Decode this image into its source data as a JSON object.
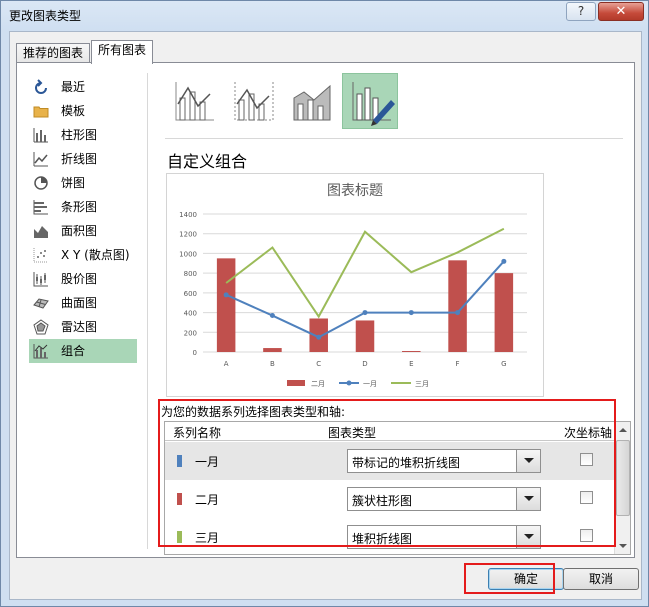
{
  "window": {
    "title": "更改图表类型",
    "help": "?",
    "close": "✕"
  },
  "tabs": [
    {
      "label": "推荐的图表"
    },
    {
      "label": "所有图表"
    }
  ],
  "sidebar": {
    "items": [
      {
        "label": "最近",
        "icon": "recent-icon"
      },
      {
        "label": "模板",
        "icon": "folder-icon"
      },
      {
        "label": "柱形图",
        "icon": "column-chart-icon"
      },
      {
        "label": "折线图",
        "icon": "line-chart-icon"
      },
      {
        "label": "饼图",
        "icon": "pie-chart-icon"
      },
      {
        "label": "条形图",
        "icon": "bar-chart-icon"
      },
      {
        "label": "面积图",
        "icon": "area-chart-icon"
      },
      {
        "label": "X Y (散点图)",
        "icon": "scatter-chart-icon"
      },
      {
        "label": "股价图",
        "icon": "stock-chart-icon"
      },
      {
        "label": "曲面图",
        "icon": "surface-chart-icon"
      },
      {
        "label": "雷达图",
        "icon": "radar-chart-icon"
      },
      {
        "label": "组合",
        "icon": "combo-chart-icon",
        "selected": true
      }
    ]
  },
  "combo_types": [
    {
      "icon": "combo-clustered-line-icon"
    },
    {
      "icon": "combo-clustered-line-secondary-icon"
    },
    {
      "icon": "combo-stacked-area-icon"
    },
    {
      "icon": "custom-combo-icon",
      "selected": true
    }
  ],
  "custom_combo": {
    "title": "自定义组合"
  },
  "chart_data": {
    "type": "bar",
    "title": "图表标题",
    "categories": [
      "A",
      "B",
      "C",
      "D",
      "E",
      "F",
      "G"
    ],
    "ylim": [
      0,
      1400
    ],
    "yticks": [
      0,
      200,
      400,
      600,
      800,
      1000,
      1200,
      1400
    ],
    "grid": true,
    "legend_position": "bottom",
    "series": [
      {
        "name": "二月",
        "kind": "bar",
        "color": "#c0504d",
        "values": [
          950,
          40,
          340,
          320,
          10,
          930,
          800
        ]
      },
      {
        "name": "一月",
        "kind": "line-marker",
        "color": "#4f81bd",
        "values": [
          580,
          370,
          150,
          400,
          400,
          400,
          920
        ]
      },
      {
        "name": "三月",
        "kind": "line",
        "color": "#9bbb59",
        "values": [
          700,
          1060,
          360,
          1220,
          810,
          1010,
          1250
        ]
      }
    ]
  },
  "series_section": {
    "prompt": "为您的数据系列选择图表类型和轴:",
    "headers": {
      "name": "系列名称",
      "type": "图表类型",
      "secondary": "次坐标轴"
    },
    "rows": [
      {
        "name": "一月",
        "color": "#4f81bd",
        "chart_type": "带标记的堆积折线图",
        "secondary_axis": false,
        "selected": true
      },
      {
        "name": "二月",
        "color": "#c0504d",
        "chart_type": "簇状柱形图",
        "secondary_axis": false
      },
      {
        "name": "三月",
        "color": "#9bbb59",
        "chart_type": "堆积折线图",
        "secondary_axis": false
      }
    ]
  },
  "buttons": {
    "ok": "确定",
    "cancel": "取消"
  }
}
